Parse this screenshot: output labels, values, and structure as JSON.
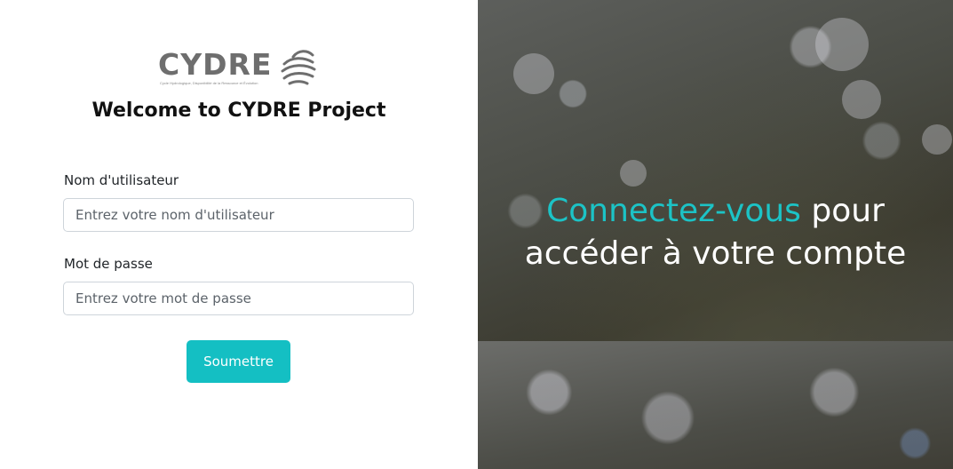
{
  "brand": {
    "logo_text": "CYDRE",
    "tagline": "Cycle Hydrologique, Disponibilité de la Ressource et Évolution"
  },
  "login": {
    "title": "Welcome to CYDRE Project",
    "username_label": "Nom d'utilisateur",
    "username_placeholder": "Entrez votre nom d'utilisateur",
    "password_label": "Mot de passe",
    "password_placeholder": "Entrez votre mot de passe",
    "submit_label": "Soumettre"
  },
  "hero": {
    "accent_text": "Connectez-vous",
    "rest_line1": " pour",
    "line2": "accéder à votre compte"
  },
  "colors": {
    "accent": "#14bfc3",
    "text": "#111111",
    "input_border": "#ced4da"
  },
  "icons": {
    "logo_mark": "wave-lines-icon"
  }
}
